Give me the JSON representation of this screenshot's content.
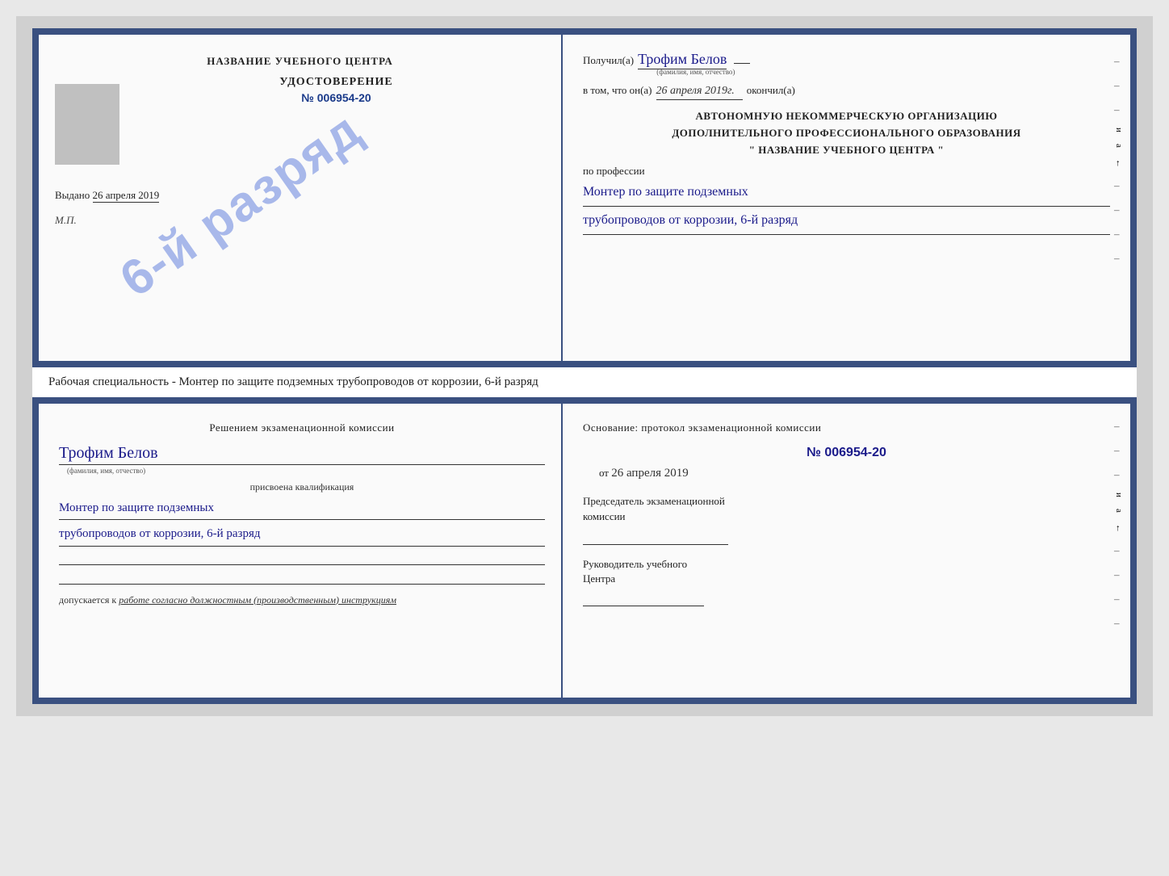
{
  "page": {
    "background": "#d0d0d0"
  },
  "top_diploma": {
    "left": {
      "title": "НАЗВАНИЕ УЧЕБНОГО ЦЕНТРА",
      "stamp_text": "6-й разряд",
      "udostoverenie_label": "УДОСТОВЕРЕНИЕ",
      "cert_number": "№ 006954-20",
      "vydano_label": "Выдано",
      "vydano_date": "26 апреля 2019",
      "mp_label": "М.П."
    },
    "right": {
      "poluchil_label": "Получил(а)",
      "recipient_name": "Трофим Белов",
      "fio_sublabel": "(фамилия, имя, отчество)",
      "vtom_label": "в том, что он(а)",
      "completion_date": "26 апреля 2019г.",
      "okончил_label": "окончил(а)",
      "org_line1": "АВТОНОМНУЮ НЕКОММЕРЧЕСКУЮ ОРГАНИЗАЦИЮ",
      "org_line2": "ДОПОЛНИТЕЛЬНОГО ПРОФЕССИОНАЛЬНОГО ОБРАЗОВАНИЯ",
      "org_line3": "\"  НАЗВАНИЕ УЧЕБНОГО ЦЕНТРА  \"",
      "po_professii_label": "по профессии",
      "profession_line1": "Монтер по защите подземных",
      "profession_line2": "трубопроводов от коррозии, 6-й разряд"
    }
  },
  "specialty_bar": {
    "text": "Рабочая специальность - Монтер по защите подземных трубопроводов от коррозии, 6-й разряд"
  },
  "bottom_cert": {
    "left": {
      "resheniem_text": "Решением экзаменационной комиссии",
      "name": "Трофим Белов",
      "fio_sublabel": "(фамилия, имя, отчество)",
      "prisvoyena_label": "присвоена квалификация",
      "profession_line1": "Монтер по защите подземных",
      "profession_line2": "трубопроводов от коррозии, 6-й разряд",
      "dopuskaetsya_label": "допускается к",
      "dopuskaetsya_value": "работе согласно должностным (производственным) инструкциям"
    },
    "right": {
      "osnovanie_label": "Основание: протокол экзаменационной комиссии",
      "protocol_number": "№  006954-20",
      "ot_label": "от",
      "ot_date": "26 апреля 2019",
      "predsedatel_line1": "Председатель экзаменационной",
      "predsedatel_line2": "комиссии",
      "rukovoditel_line1": "Руководитель учебного",
      "rukovoditel_line2": "Центра"
    }
  }
}
